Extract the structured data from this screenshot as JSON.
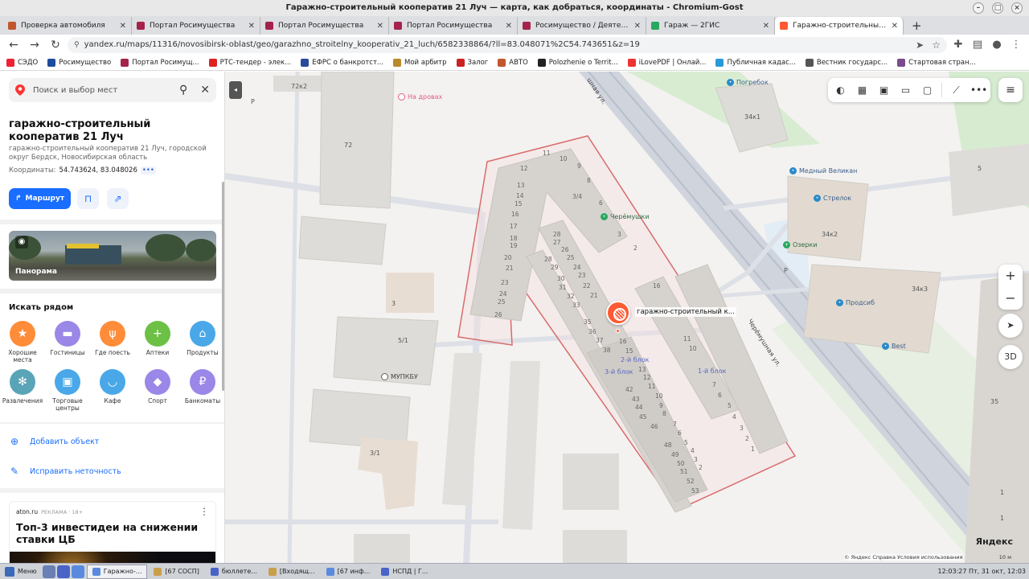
{
  "window": {
    "title": "Гаражно-строительный кооператив 21 Луч — карта, как добраться, координаты - Chromium-Gost"
  },
  "tabs": [
    {
      "title": "Проверка автомобиля",
      "color": "#c2572f"
    },
    {
      "title": "Портал Росимущества",
      "color": "#a5224a"
    },
    {
      "title": "Портал Росимущества",
      "color": "#a5224a"
    },
    {
      "title": "Портал Росимущества",
      "color": "#a5224a"
    },
    {
      "title": "Росимущество / Деятельност",
      "color": "#a5224a"
    },
    {
      "title": "Гараж — 2ГИС",
      "color": "#2aa760"
    },
    {
      "title": "Гаражно-строительный кооп",
      "color": "#ff5a34",
      "active": true
    }
  ],
  "url": "yandex.ru/maps/11316/novosibirsk-oblast/geo/garazhno_stroitelny_kooperativ_21_luch/6582338864/?ll=83.048071%2C54.743651&z=19",
  "bookmarks": [
    {
      "label": "СЭДО",
      "color": "#e23"
    },
    {
      "label": "Росимущество",
      "color": "#1c4d9c"
    },
    {
      "label": "Портал Росимущ...",
      "color": "#a5224a"
    },
    {
      "label": "РТС-тендер - элек...",
      "color": "#d22"
    },
    {
      "label": "ЕФРС о банкротст...",
      "color": "#2a4b9b"
    },
    {
      "label": "Мой арбитр",
      "color": "#b88a2a"
    },
    {
      "label": "Залог",
      "color": "#c22"
    },
    {
      "label": "АВТО",
      "color": "#c2572f"
    },
    {
      "label": "Polozhenie o Territ...",
      "color": "#222"
    },
    {
      "label": "iLovePDF | Онлай...",
      "color": "#e33"
    },
    {
      "label": "Публичная кадас...",
      "color": "#2a9ad6"
    },
    {
      "label": "Вестник государс...",
      "color": "#555"
    },
    {
      "label": "Стартовая стран...",
      "color": "#7a4b8c"
    }
  ],
  "sidebar": {
    "search_placeholder": "Поиск и выбор мест",
    "org_title": "гаражно-строительный кооператив 21 Луч",
    "org_subtitle": "гаражно-строительный кооператив 21 Луч, городской округ Бердск, Новосибирская область",
    "coords_label": "Координаты:",
    "coords_value": "54.743624, 83.048026",
    "route_label": "Маршрут",
    "panorama_label": "Панорама",
    "nearby_title": "Искать рядом",
    "categories": [
      {
        "label": "Хорошие места",
        "color": "#ff8c38",
        "icon": "★"
      },
      {
        "label": "Гостиницы",
        "color": "#9b87e8",
        "icon": "▬"
      },
      {
        "label": "Где поесть",
        "color": "#ff8c38",
        "icon": "ψ"
      },
      {
        "label": "Аптеки",
        "color": "#6cc045",
        "icon": "+"
      },
      {
        "label": "Продукты",
        "color": "#4aa8e8",
        "icon": "⌂"
      },
      {
        "label": "Развлечения",
        "color": "#5aa4b8",
        "icon": "✻"
      },
      {
        "label": "Торговые центры",
        "color": "#4aa8e8",
        "icon": "▣"
      },
      {
        "label": "Кафе",
        "color": "#4aa8e8",
        "icon": "◡"
      },
      {
        "label": "Спорт",
        "color": "#9b87e8",
        "icon": "◆"
      },
      {
        "label": "Банкоматы",
        "color": "#9b87e8",
        "icon": "₽"
      }
    ],
    "add_object": "Добавить объект",
    "fix_error": "Исправить неточность",
    "ad": {
      "source": "aton.ru",
      "tag": "РЕКЛАМА · 18+",
      "headline": "Топ-3 инвестидеи на снижении ставки ЦБ"
    }
  },
  "map": {
    "pois": [
      {
        "label": "На дровах",
        "style": "pink"
      },
      {
        "label": "Погребок",
        "style": "blue"
      },
      {
        "label": "Черёмушки",
        "style": "green"
      },
      {
        "label": "Медный Великан",
        "style": "blue"
      },
      {
        "label": "Стрелок",
        "style": "blue"
      },
      {
        "label": "Озерки",
        "style": "green"
      },
      {
        "label": "Продсиб",
        "style": "blue"
      },
      {
        "label": "Best",
        "style": "blue"
      },
      {
        "label": "МУПКБУ",
        "style": "grey"
      }
    ],
    "streets": [
      "Черёмушная ул.",
      "шная ул."
    ],
    "buildings": [
      "72к2",
      "72",
      "34к1",
      "34к2",
      "34к3",
      "3",
      "5/1",
      "3/1",
      "35",
      "5",
      "1",
      "1"
    ],
    "block_labels": [
      "2-й блок",
      "3-й блок",
      "1-й блок"
    ],
    "marker_label": "гаражно-строительный к...",
    "brand": "Яндекс",
    "copyright": "© Яндекс   Справка   Условия использования",
    "scale": "10 м",
    "btn_3d": "3D",
    "zoom_in": "+",
    "zoom_out": "−"
  },
  "taskbar": {
    "start_label": "Меню",
    "items": [
      {
        "label": "Гаражно-...",
        "active": true
      },
      {
        "label": "[67 СОСП]"
      },
      {
        "label": "бюллете..."
      },
      {
        "label": "[Входящ..."
      },
      {
        "label": "[67 инф..."
      },
      {
        "label": "НСПД | Г..."
      }
    ],
    "clock": "12:03:27  Пт, 31 окт, 12:03"
  }
}
